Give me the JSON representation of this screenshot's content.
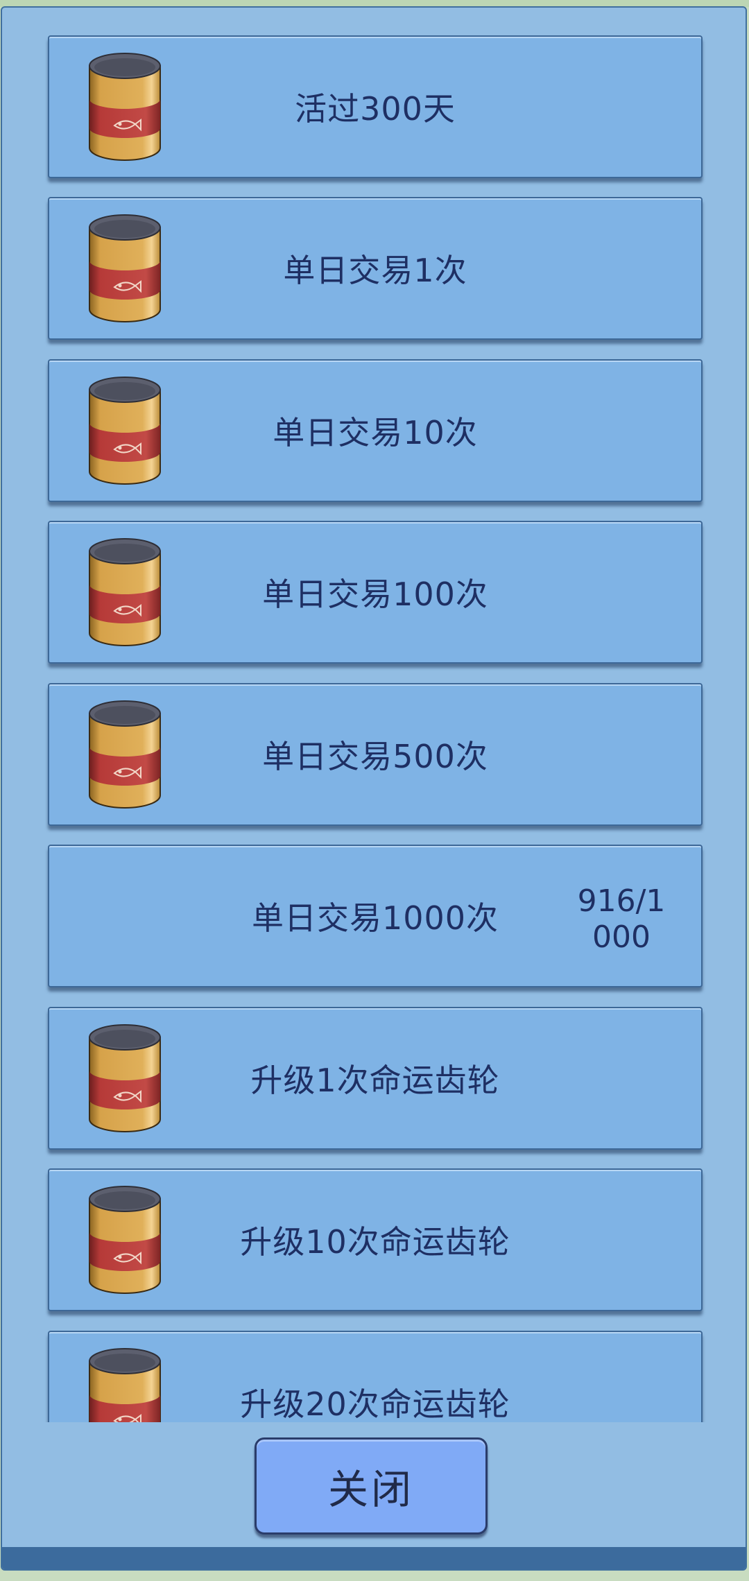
{
  "achievements": [
    {
      "title": "活过300天",
      "reward_icon": "fish-can-icon",
      "progress": ""
    },
    {
      "title": "单日交易1次",
      "reward_icon": "fish-can-icon",
      "progress": ""
    },
    {
      "title": "单日交易10次",
      "reward_icon": "fish-can-icon",
      "progress": ""
    },
    {
      "title": "单日交易100次",
      "reward_icon": "fish-can-icon",
      "progress": ""
    },
    {
      "title": "单日交易500次",
      "reward_icon": "fish-can-icon",
      "progress": ""
    },
    {
      "title": "单日交易1000次",
      "reward_icon": "",
      "progress": "916/1000"
    },
    {
      "title": "升级1次命运齿轮",
      "reward_icon": "fish-can-icon",
      "progress": ""
    },
    {
      "title": "升级10次命运齿轮",
      "reward_icon": "fish-can-icon",
      "progress": ""
    },
    {
      "title": "升级20次命运齿轮",
      "reward_icon": "fish-can-icon",
      "progress": ""
    }
  ],
  "close_button": {
    "label": "关闭"
  },
  "colors": {
    "card": "#7fb3e5",
    "panel": "#92bde3",
    "text": "#1e2f63",
    "button": "#80aaf6"
  }
}
